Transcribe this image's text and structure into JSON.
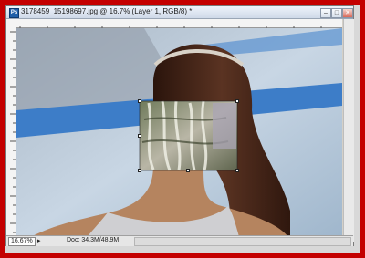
{
  "window": {
    "title": "3178459_15198697.jpg @ 16.7% (Layer 1, RGB/8) *",
    "app_icon_label": "Ps",
    "minimize_glyph": "–",
    "maximize_glyph": "□",
    "close_glyph": "✕"
  },
  "status": {
    "zoom": "16.67%",
    "doc": "Doc: 34.3M/48.9M",
    "nav_arrow": "▸"
  },
  "colors": {
    "border_red": "#c40000",
    "sky": "#bcd0e4",
    "stripe_blue": "#3d7dc8",
    "hair": "#3a1f14",
    "skin": "#b5845f",
    "top_silver": "#cfcfd2"
  },
  "icons": [
    "photoshop-app-icon",
    "minimize-icon",
    "maximize-icon",
    "close-icon",
    "status-nav-icon"
  ]
}
